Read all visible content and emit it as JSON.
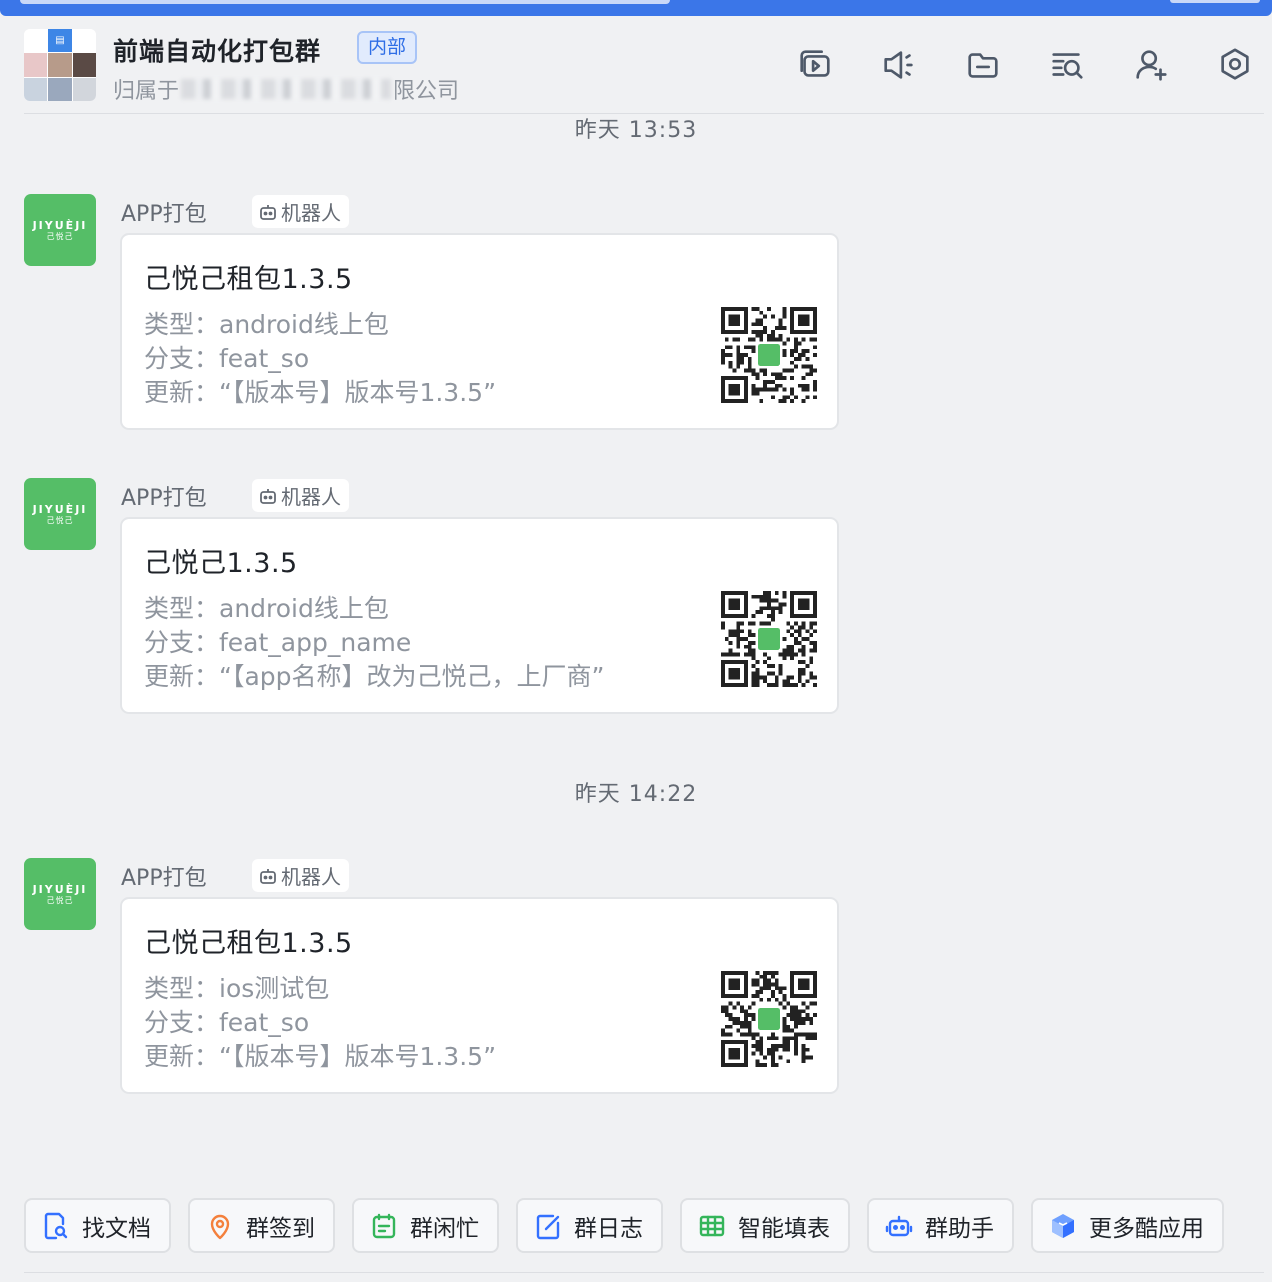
{
  "header": {
    "title": "前端自动化打包群",
    "tag": "内部",
    "subtitle_prefix": "归属于",
    "subtitle_suffix": "限公司",
    "icons": [
      "screen-share-icon",
      "announcement-icon",
      "folder-icon",
      "search-history-icon",
      "add-member-icon",
      "settings-icon"
    ]
  },
  "messages": [
    {
      "time": "昨天 13:53",
      "sender": "APP打包",
      "bot_label": "机器人",
      "avatar_text": "JIYUÈJI",
      "avatar_sub": "己悦己",
      "title": "己悦己租包1.3.5",
      "line1": "类型：android线上包",
      "line2": "分支：feat_so",
      "line3": "更新：“【版本号】版本号1.3.5”"
    },
    {
      "sender": "APP打包",
      "bot_label": "机器人",
      "avatar_text": "JIYUÈJI",
      "avatar_sub": "己悦己",
      "title": "己悦己1.3.5",
      "line1": "类型：android线上包",
      "line2": "分支：feat_app_name",
      "line3": "更新：“【app名称】改为己悦己，上厂商”"
    },
    {
      "time": "昨天 14:22",
      "sender": "APP打包",
      "bot_label": "机器人",
      "avatar_text": "JIYUÈJI",
      "avatar_sub": "己悦己",
      "title": "己悦己租包1.3.5",
      "line1": "类型：ios测试包",
      "line2": "分支：feat_so",
      "line3": "更新：“【版本号】版本号1.3.5”"
    }
  ],
  "apps": [
    {
      "label": "找文档",
      "color": "#3370ff"
    },
    {
      "label": "群签到",
      "color": "#f4803c"
    },
    {
      "label": "群闲忙",
      "color": "#34b55a"
    },
    {
      "label": "群日志",
      "color": "#3370ff"
    },
    {
      "label": "智能填表",
      "color": "#34b55a"
    },
    {
      "label": "群助手",
      "color": "#3370ff"
    },
    {
      "label": "更多酷应用",
      "color": "#3370ff"
    }
  ]
}
